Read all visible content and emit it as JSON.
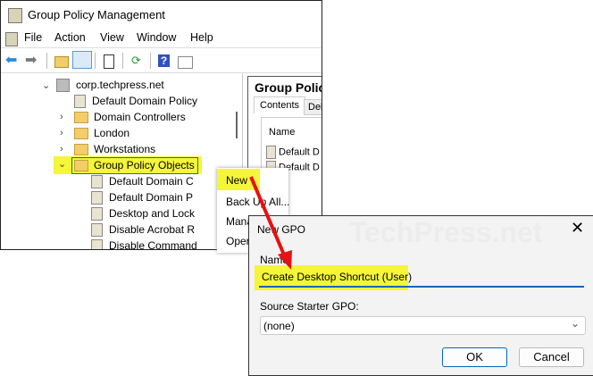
{
  "window": {
    "title": "Group Policy Management"
  },
  "menu": [
    "File",
    "Action",
    "View",
    "Window",
    "Help"
  ],
  "tree": {
    "domain": "corp.techpress.net",
    "items": [
      "Default Domain Policy",
      "Domain Controllers",
      "London",
      "Workstations",
      "Group Policy Objects"
    ],
    "gpos": [
      "Default Domain C",
      "Default Domain P",
      "Desktop and Lock",
      "Disable Acrobat R",
      "Disable Command"
    ]
  },
  "right_pane": {
    "title": "Group Polic",
    "tabs": [
      "Contents",
      "Del"
    ],
    "column": "Name",
    "rows": [
      "Default D",
      "Default D"
    ]
  },
  "context_menu": [
    "New",
    "Back Up All...",
    "Mana",
    "Oper"
  ],
  "dialog": {
    "title": "New GPO",
    "name_label": "Name:",
    "name_value": "Create Desktop Shortcut (User)",
    "source_label": "Source Starter GPO:",
    "source_value": "(none)",
    "ok": "OK",
    "cancel": "Cancel",
    "watermark": "TechPress.net"
  },
  "colors": {
    "highlight": "#f5f53a",
    "arrow": "#e81010",
    "accent": "#0067c0"
  }
}
